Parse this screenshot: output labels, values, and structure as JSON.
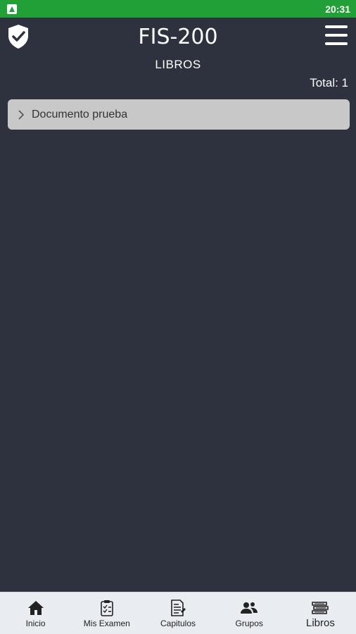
{
  "status_bar": {
    "time": "20:31"
  },
  "header": {
    "title": "FIS-200",
    "subtitle": "LIBROS",
    "total": "Total: 1"
  },
  "books": [
    {
      "title": "Documento prueba"
    }
  ],
  "bottom_nav": [
    {
      "label": "Inicio",
      "icon": "home-icon"
    },
    {
      "label": "Mis Examen",
      "icon": "clipboard-icon"
    },
    {
      "label": "Capitulos",
      "icon": "document-list-icon"
    },
    {
      "label": "Grupos",
      "icon": "group-icon"
    },
    {
      "label": "Libros",
      "icon": "books-icon",
      "active": true
    }
  ],
  "colors": {
    "status_bar": "#21a038",
    "background": "#2d323e",
    "list_item": "#c8c8c8",
    "nav_bar": "#e9ecf1"
  }
}
